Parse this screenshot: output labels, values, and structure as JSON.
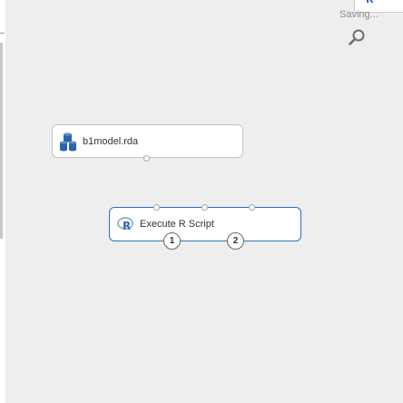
{
  "status": {
    "saving_text": "Saving..."
  },
  "toolbar": {
    "zoom_icon": "magnifier-icon"
  },
  "modules": [
    {
      "id": "dataset",
      "label": "b1model.rda",
      "icon": "dataset-icon",
      "selected": false
    },
    {
      "id": "rscript",
      "label": "Execute R Script",
      "icon": "r-language-icon",
      "selected": true,
      "output_ports": [
        "1",
        "2"
      ]
    }
  ],
  "colors": {
    "canvas_background": "#eeeeee",
    "selected_border": "#2a72c4",
    "module_border": "#c4c4c4",
    "r_icon_blue": "#2f6bbf",
    "dataset_icon_blue": "#2a64b0"
  }
}
